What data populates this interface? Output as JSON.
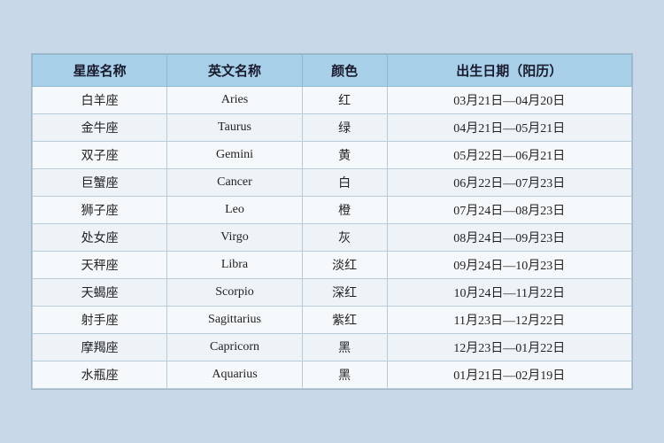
{
  "table": {
    "headers": [
      "星座名称",
      "英文名称",
      "颜色",
      "出生日期（阳历）"
    ],
    "rows": [
      {
        "zh": "白羊座",
        "en": "Aries",
        "color": "红",
        "dates": "03月21日—04月20日"
      },
      {
        "zh": "金牛座",
        "en": "Taurus",
        "color": "绿",
        "dates": "04月21日—05月21日"
      },
      {
        "zh": "双子座",
        "en": "Gemini",
        "color": "黄",
        "dates": "05月22日—06月21日"
      },
      {
        "zh": "巨蟹座",
        "en": "Cancer",
        "color": "白",
        "dates": "06月22日—07月23日"
      },
      {
        "zh": "狮子座",
        "en": "Leo",
        "color": "橙",
        "dates": "07月24日—08月23日"
      },
      {
        "zh": "处女座",
        "en": "Virgo",
        "color": "灰",
        "dates": "08月24日—09月23日"
      },
      {
        "zh": "天秤座",
        "en": "Libra",
        "color": "淡红",
        "dates": "09月24日—10月23日"
      },
      {
        "zh": "天蝎座",
        "en": "Scorpio",
        "color": "深红",
        "dates": "10月24日—11月22日"
      },
      {
        "zh": "射手座",
        "en": "Sagittarius",
        "color": "紫红",
        "dates": "11月23日—12月22日"
      },
      {
        "zh": "摩羯座",
        "en": "Capricorn",
        "color": "黑",
        "dates": "12月23日—01月22日"
      },
      {
        "zh": "水瓶座",
        "en": "Aquarius",
        "color": "黑",
        "dates": "01月21日—02月19日"
      }
    ]
  }
}
